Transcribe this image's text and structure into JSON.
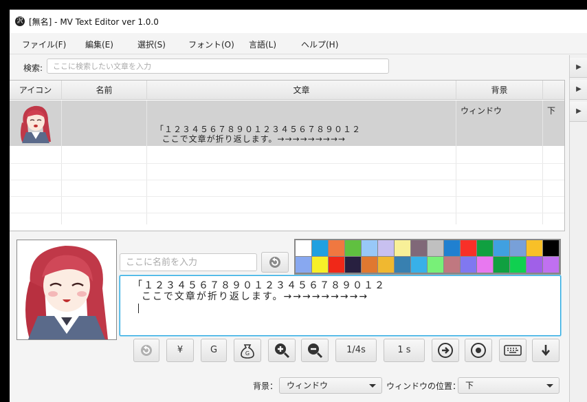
{
  "window": {
    "title": "[無名] - MV Text Editor ver 1.0.0",
    "app_icon": "沢"
  },
  "menu": [
    {
      "label": "ファイル(F)"
    },
    {
      "label": "編集(E)"
    },
    {
      "label": "選択(S)"
    },
    {
      "label": "フォント(O)"
    },
    {
      "label": "言語(L)"
    },
    {
      "label": "ヘルプ(H)"
    }
  ],
  "search": {
    "label": "検索:",
    "placeholder": "ここに検索したい文章を入力",
    "value": ""
  },
  "table": {
    "columns": [
      "アイコン",
      "名前",
      "文章",
      "背景"
    ],
    "rows": [
      {
        "name": "",
        "text_line1": "「１２３４５６７８９０１２３４５６７８９０１２",
        "text_line2": "  ここで文章が折り返します。→→→→→→→→→",
        "background": "ウィンドウ",
        "position": "下"
      }
    ]
  },
  "side_buttons": [
    "expand-arrow-icon",
    "expand-arrow-icon",
    "expand-arrow-icon"
  ],
  "editor": {
    "name_placeholder": "ここに名前を入力",
    "name_value": "",
    "text_line1": "「１２３４５６７８９０１２３４５６７８９０１２",
    "text_line2": "  ここで文章が折り返します。→→→→→→→→→"
  },
  "palette": {
    "colors": [
      "#ffffff",
      "#20a0e0",
      "#f07840",
      "#60c040",
      "#98c8f8",
      "#c8c0f0",
      "#f8f098",
      "#806878",
      "#c0c0c0",
      "#2080d0",
      "#f83028",
      "#10a040",
      "#40a0e0",
      "#78a0d8",
      "#f8c028",
      "#000000",
      "#88a8f0",
      "#f8f028",
      "#f02818",
      "#282040",
      "#e07830",
      "#f0b830",
      "#3880b0",
      "#38b0e8",
      "#78f078",
      "#c07880",
      "#8078f0",
      "#e878f0",
      "#10a040",
      "#10d050",
      "#a060e8",
      "#c070f0"
    ]
  },
  "toolbar": {
    "g_label": "G",
    "yen_label": "¥",
    "quarter_label": "1/4s",
    "second_label": "1 s"
  },
  "bottom": {
    "background_label": "背景：",
    "background_value": "ウィンドウ",
    "position_label": "ウィンドウの位置：",
    "position_value": "下"
  }
}
